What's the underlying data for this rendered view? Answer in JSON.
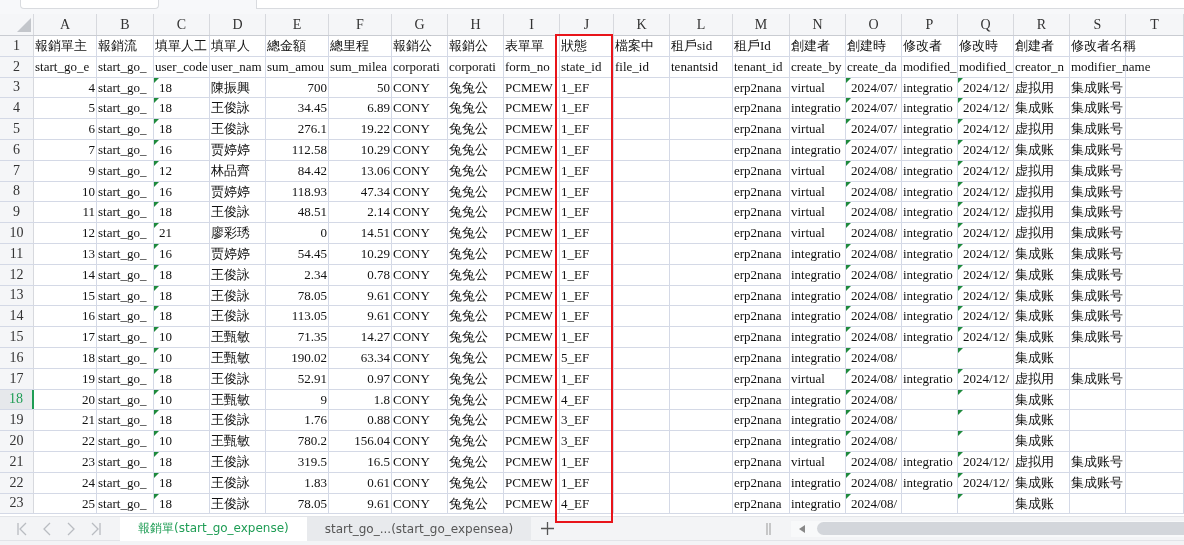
{
  "sheet": {
    "columns": [
      {
        "letter": "A",
        "kind": "number",
        "highlighted": false
      },
      {
        "letter": "B",
        "kind": "text",
        "highlighted": false
      },
      {
        "letter": "C",
        "kind": "flagged",
        "highlighted": false
      },
      {
        "letter": "D",
        "kind": "text",
        "highlighted": false
      },
      {
        "letter": "E",
        "kind": "number",
        "highlighted": false
      },
      {
        "letter": "F",
        "kind": "number",
        "highlighted": false
      },
      {
        "letter": "G",
        "kind": "text",
        "highlighted": false
      },
      {
        "letter": "H",
        "kind": "text",
        "highlighted": false
      },
      {
        "letter": "I",
        "kind": "text",
        "highlighted": false
      },
      {
        "letter": "J",
        "kind": "text",
        "highlighted": true
      },
      {
        "letter": "K",
        "kind": "text",
        "highlighted": false
      },
      {
        "letter": "L",
        "kind": "text",
        "highlighted": false
      },
      {
        "letter": "M",
        "kind": "text",
        "highlighted": false
      },
      {
        "letter": "N",
        "kind": "text",
        "highlighted": false
      },
      {
        "letter": "O",
        "kind": "flagged",
        "highlighted": false
      },
      {
        "letter": "P",
        "kind": "text",
        "highlighted": false
      },
      {
        "letter": "Q",
        "kind": "flagged",
        "highlighted": false
      },
      {
        "letter": "R",
        "kind": "text",
        "highlighted": false
      },
      {
        "letter": "S",
        "kind": "text",
        "highlighted": false
      },
      {
        "letter": "T",
        "kind": "text",
        "highlighted": false
      }
    ],
    "rows": [
      {
        "number": "1",
        "kind": "label",
        "selected": false,
        "cells": {
          "A": "報銷單主",
          "B": "報銷流",
          "C": "填單人工",
          "D": "填單人",
          "E": "總金額",
          "F": "總里程",
          "G": "報銷公",
          "H": "報銷公",
          "I": "表單單",
          "J": "狀態",
          "K": "檔案中",
          "L": "租戶sid",
          "M": "租戶Id",
          "N": "創建者",
          "O": "創建時",
          "P": "修改者",
          "Q": "修改時",
          "R": "創建者",
          "S": "修改者名稱"
        }
      },
      {
        "number": "2",
        "kind": "label",
        "selected": false,
        "cells": {
          "A": "start_go_e",
          "B": "start_go_",
          "C": "user_code",
          "D": "user_nam",
          "E": "sum_amou",
          "F": "sum_milea",
          "G": "corporati",
          "H": "corporati",
          "I": "form_no",
          "J": "state_id",
          "K": "file_id",
          "L": "tenantsid",
          "M": "tenant_id",
          "N": "create_by",
          "O": "create_da",
          "P": "modified_",
          "Q": "modified_",
          "R": "creator_n",
          "S": "modifier_name"
        }
      },
      {
        "number": "3",
        "kind": "data",
        "selected": false,
        "cells": {
          "A": "4",
          "B": "start_go_",
          "C": "18",
          "D": "陳振興",
          "E": "700",
          "F": "50",
          "G": "CONY",
          "H": "兔兔公",
          "I": "PCMEW",
          "J": "1_EF",
          "M": "erp2nana",
          "N": "virtual",
          "O": "2024/07/",
          "P": "integratio",
          "Q": "2024/12/",
          "R": "虚拟用",
          "S": "集成账号"
        }
      },
      {
        "number": "4",
        "kind": "data",
        "selected": false,
        "cells": {
          "A": "5",
          "B": "start_go_",
          "C": "18",
          "D": "王俊詠",
          "E": "34.45",
          "F": "6.89",
          "G": "CONY",
          "H": "兔兔公",
          "I": "PCMEW",
          "J": "1_EF",
          "M": "erp2nana",
          "N": "integratio",
          "O": "2024/07/",
          "P": "integratio",
          "Q": "2024/12/",
          "R": "集成账",
          "S": "集成账号"
        }
      },
      {
        "number": "5",
        "kind": "data",
        "selected": false,
        "cells": {
          "A": "6",
          "B": "start_go_",
          "C": "18",
          "D": "王俊詠",
          "E": "276.1",
          "F": "19.22",
          "G": "CONY",
          "H": "兔兔公",
          "I": "PCMEW",
          "J": "1_EF",
          "M": "erp2nana",
          "N": "virtual",
          "O": "2024/07/",
          "P": "integratio",
          "Q": "2024/12/",
          "R": "虚拟用",
          "S": "集成账号"
        }
      },
      {
        "number": "6",
        "kind": "data",
        "selected": false,
        "cells": {
          "A": "7",
          "B": "start_go_",
          "C": "16",
          "D": "贾婷婷",
          "E": "112.58",
          "F": "10.29",
          "G": "CONY",
          "H": "兔兔公",
          "I": "PCMEW",
          "J": "1_EF",
          "M": "erp2nana",
          "N": "integratio",
          "O": "2024/07/",
          "P": "integratio",
          "Q": "2024/12/",
          "R": "集成账",
          "S": "集成账号"
        }
      },
      {
        "number": "7",
        "kind": "data",
        "selected": false,
        "cells": {
          "A": "9",
          "B": "start_go_",
          "C": "12",
          "D": "林品齊",
          "E": "84.42",
          "F": "13.06",
          "G": "CONY",
          "H": "兔兔公",
          "I": "PCMEW",
          "J": "1_EF",
          "M": "erp2nana",
          "N": "virtual",
          "O": "2024/08/",
          "P": "integratio",
          "Q": "2024/12/",
          "R": "虚拟用",
          "S": "集成账号"
        }
      },
      {
        "number": "8",
        "kind": "data",
        "selected": false,
        "cells": {
          "A": "10",
          "B": "start_go_",
          "C": "16",
          "D": "贾婷婷",
          "E": "118.93",
          "F": "47.34",
          "G": "CONY",
          "H": "兔兔公",
          "I": "PCMEW",
          "J": "1_EF",
          "M": "erp2nana",
          "N": "virtual",
          "O": "2024/08/",
          "P": "integratio",
          "Q": "2024/12/",
          "R": "虚拟用",
          "S": "集成账号"
        }
      },
      {
        "number": "9",
        "kind": "data",
        "selected": false,
        "cells": {
          "A": "11",
          "B": "start_go_",
          "C": "18",
          "D": "王俊詠",
          "E": "48.51",
          "F": "2.14",
          "G": "CONY",
          "H": "兔兔公",
          "I": "PCMEW",
          "J": "1_EF",
          "M": "erp2nana",
          "N": "virtual",
          "O": "2024/08/",
          "P": "integratio",
          "Q": "2024/12/",
          "R": "虚拟用",
          "S": "集成账号"
        }
      },
      {
        "number": "10",
        "kind": "data",
        "selected": false,
        "cells": {
          "A": "12",
          "B": "start_go_",
          "C": "21",
          "D": "廖彩琇",
          "E": "0",
          "F": "14.51",
          "G": "CONY",
          "H": "兔兔公",
          "I": "PCMEW",
          "J": "1_EF",
          "M": "erp2nana",
          "N": "virtual",
          "O": "2024/08/",
          "P": "integratio",
          "Q": "2024/12/",
          "R": "虚拟用",
          "S": "集成账号"
        }
      },
      {
        "number": "11",
        "kind": "data",
        "selected": false,
        "cells": {
          "A": "13",
          "B": "start_go_",
          "C": "16",
          "D": "贾婷婷",
          "E": "54.45",
          "F": "10.29",
          "G": "CONY",
          "H": "兔兔公",
          "I": "PCMEW",
          "J": "1_EF",
          "M": "erp2nana",
          "N": "integratio",
          "O": "2024/08/",
          "P": "integratio",
          "Q": "2024/12/",
          "R": "集成账",
          "S": "集成账号"
        }
      },
      {
        "number": "12",
        "kind": "data",
        "selected": false,
        "cells": {
          "A": "14",
          "B": "start_go_",
          "C": "18",
          "D": "王俊詠",
          "E": "2.34",
          "F": "0.78",
          "G": "CONY",
          "H": "兔兔公",
          "I": "PCMEW",
          "J": "1_EF",
          "M": "erp2nana",
          "N": "integratio",
          "O": "2024/08/",
          "P": "integratio",
          "Q": "2024/12/",
          "R": "集成账",
          "S": "集成账号"
        }
      },
      {
        "number": "13",
        "kind": "data",
        "selected": false,
        "cells": {
          "A": "15",
          "B": "start_go_",
          "C": "18",
          "D": "王俊詠",
          "E": "78.05",
          "F": "9.61",
          "G": "CONY",
          "H": "兔兔公",
          "I": "PCMEW",
          "J": "1_EF",
          "M": "erp2nana",
          "N": "integratio",
          "O": "2024/08/",
          "P": "integratio",
          "Q": "2024/12/",
          "R": "集成账",
          "S": "集成账号"
        }
      },
      {
        "number": "14",
        "kind": "data",
        "selected": false,
        "cells": {
          "A": "16",
          "B": "start_go_",
          "C": "18",
          "D": "王俊詠",
          "E": "113.05",
          "F": "9.61",
          "G": "CONY",
          "H": "兔兔公",
          "I": "PCMEW",
          "J": "1_EF",
          "M": "erp2nana",
          "N": "integratio",
          "O": "2024/08/",
          "P": "integratio",
          "Q": "2024/12/",
          "R": "集成账",
          "S": "集成账号"
        }
      },
      {
        "number": "15",
        "kind": "data",
        "selected": false,
        "cells": {
          "A": "17",
          "B": "start_go_",
          "C": "10",
          "D": "王甄敏",
          "E": "71.35",
          "F": "14.27",
          "G": "CONY",
          "H": "兔兔公",
          "I": "PCMEW",
          "J": "1_EF",
          "M": "erp2nana",
          "N": "integratio",
          "O": "2024/08/",
          "P": "integratio",
          "Q": "2024/12/",
          "R": "集成账",
          "S": "集成账号"
        }
      },
      {
        "number": "16",
        "kind": "data",
        "selected": false,
        "cells": {
          "A": "18",
          "B": "start_go_",
          "C": "10",
          "D": "王甄敏",
          "E": "190.02",
          "F": "63.34",
          "G": "CONY",
          "H": "兔兔公",
          "I": "PCMEW",
          "J": "5_EF",
          "M": "erp2nana",
          "N": "integratio",
          "O": "2024/08/",
          "R": "集成账"
        }
      },
      {
        "number": "17",
        "kind": "data",
        "selected": false,
        "cells": {
          "A": "19",
          "B": "start_go_",
          "C": "18",
          "D": "王俊詠",
          "E": "52.91",
          "F": "0.97",
          "G": "CONY",
          "H": "兔兔公",
          "I": "PCMEW",
          "J": "1_EF",
          "M": "erp2nana",
          "N": "virtual",
          "O": "2024/08/",
          "P": "integratio",
          "Q": "2024/12/",
          "R": "虚拟用",
          "S": "集成账号"
        }
      },
      {
        "number": "18",
        "kind": "data",
        "selected": true,
        "cells": {
          "A": "20",
          "B": "start_go_",
          "C": "10",
          "D": "王甄敏",
          "E": "9",
          "F": "1.8",
          "G": "CONY",
          "H": "兔兔公",
          "I": "PCMEW",
          "J": "4_EF",
          "M": "erp2nana",
          "N": "integratio",
          "O": "2024/08/",
          "R": "集成账"
        }
      },
      {
        "number": "19",
        "kind": "data",
        "selected": false,
        "cells": {
          "A": "21",
          "B": "start_go_",
          "C": "18",
          "D": "王俊詠",
          "E": "1.76",
          "F": "0.88",
          "G": "CONY",
          "H": "兔兔公",
          "I": "PCMEW",
          "J": "3_EF",
          "M": "erp2nana",
          "N": "integratio",
          "O": "2024/08/",
          "R": "集成账"
        }
      },
      {
        "number": "20",
        "kind": "data",
        "selected": false,
        "cells": {
          "A": "22",
          "B": "start_go_",
          "C": "10",
          "D": "王甄敏",
          "E": "780.2",
          "F": "156.04",
          "G": "CONY",
          "H": "兔兔公",
          "I": "PCMEW",
          "J": "3_EF",
          "M": "erp2nana",
          "N": "integratio",
          "O": "2024/08/",
          "R": "集成账"
        }
      },
      {
        "number": "21",
        "kind": "data",
        "selected": false,
        "cells": {
          "A": "23",
          "B": "start_go_",
          "C": "18",
          "D": "王俊詠",
          "E": "319.5",
          "F": "16.5",
          "G": "CONY",
          "H": "兔兔公",
          "I": "PCMEW",
          "J": "1_EF",
          "M": "erp2nana",
          "N": "virtual",
          "O": "2024/08/",
          "P": "integratio",
          "Q": "2024/12/",
          "R": "虚拟用",
          "S": "集成账号"
        }
      },
      {
        "number": "22",
        "kind": "data",
        "selected": false,
        "cells": {
          "A": "24",
          "B": "start_go_",
          "C": "18",
          "D": "王俊詠",
          "E": "1.83",
          "F": "0.61",
          "G": "CONY",
          "H": "兔兔公",
          "I": "PCMEW",
          "J": "1_EF",
          "M": "erp2nana",
          "N": "integratio",
          "O": "2024/08/",
          "P": "integratio",
          "Q": "2024/12/",
          "R": "集成账",
          "S": "集成账号"
        }
      },
      {
        "number": "23",
        "kind": "data",
        "selected": false,
        "cells": {
          "A": "25",
          "B": "start_go_",
          "C": "18",
          "D": "王俊詠",
          "E": "78.05",
          "F": "9.61",
          "G": "CONY",
          "H": "兔兔公",
          "I": "PCMEW",
          "J": "4_EF",
          "M": "erp2nana",
          "N": "integratio",
          "O": "2024/08/",
          "R": "集成账"
        }
      }
    ]
  },
  "sheet_tabs": [
    {
      "label": "報銷單(start_go_expense)",
      "selected": true
    },
    {
      "label": "start_go_...(start_go_expensea)",
      "selected": false
    }
  ]
}
